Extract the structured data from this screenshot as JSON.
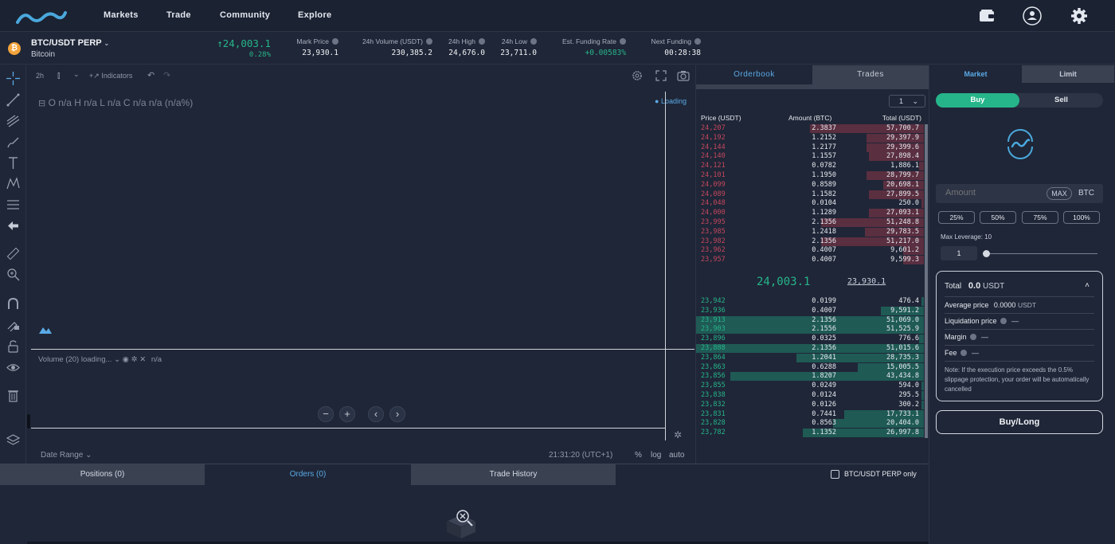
{
  "nav": {
    "links": [
      "Markets",
      "Trade",
      "Community",
      "Explore"
    ]
  },
  "ticker": {
    "pair": "BTC/USDT PERP",
    "name": "Bitcoin",
    "coin_symbol": "₿",
    "last_price": "24,003.1",
    "change": "0.28%",
    "stats": [
      {
        "label": "Mark Price",
        "value": "23,930.1"
      },
      {
        "label": "24h Volume (USDT)",
        "value": "230,385.2"
      },
      {
        "label": "24h High",
        "value": "24,676.0"
      },
      {
        "label": "24h Low",
        "value": "23,711.0"
      },
      {
        "label": "Est. Funding Rate",
        "value": "+0.00583%"
      },
      {
        "label": "Next Funding",
        "value": "00:28:38"
      }
    ]
  },
  "chart": {
    "interval": "2h",
    "indicators_label": "Indicators",
    "ohlc": "O n/a  H n/a  L n/a  C n/a  n/a (n/a%)",
    "loading": "Loading",
    "volume_label": "Volume (20) loading...",
    "volume_value": "n/a",
    "date_range": "Date Range",
    "time": "21:31:20 (UTC+1)",
    "axis_options": [
      "%",
      "log",
      "auto"
    ]
  },
  "orderbook": {
    "tabs": [
      "Orderbook",
      "Trades"
    ],
    "grouping": "1",
    "columns": [
      "Price (USDT)",
      "Amount (BTC)",
      "Total (USDT)"
    ],
    "asks": [
      {
        "price": "24,207",
        "amount": "2.3837",
        "total": "57,700.7",
        "depth": 0.5
      },
      {
        "price": "24,192",
        "amount": "1.2152",
        "total": "29,397.9",
        "depth": 0.25
      },
      {
        "price": "24,144",
        "amount": "1.2177",
        "total": "29,399.6",
        "depth": 0.25
      },
      {
        "price": "24,140",
        "amount": "1.1557",
        "total": "27,898.4",
        "depth": 0.24
      },
      {
        "price": "24,121",
        "amount": "0.0782",
        "total": "1,886.1",
        "depth": 0.02
      },
      {
        "price": "24,101",
        "amount": "1.1950",
        "total": "28,799.7",
        "depth": 0.25
      },
      {
        "price": "24,099",
        "amount": "0.8589",
        "total": "20,698.1",
        "depth": 0.18
      },
      {
        "price": "24,089",
        "amount": "1.1582",
        "total": "27,899.5",
        "depth": 0.24
      },
      {
        "price": "24,048",
        "amount": "0.0104",
        "total": "250.0",
        "depth": 0.01
      },
      {
        "price": "24,000",
        "amount": "1.1289",
        "total": "27,093.1",
        "depth": 0.24
      },
      {
        "price": "23,995",
        "amount": "2.1356",
        "total": "51,248.8",
        "depth": 0.45
      },
      {
        "price": "23,985",
        "amount": "1.2418",
        "total": "29,783.5",
        "depth": 0.26
      },
      {
        "price": "23,982",
        "amount": "2.1356",
        "total": "51,217.0",
        "depth": 0.45
      },
      {
        "price": "23,962",
        "amount": "0.4007",
        "total": "9,601.2",
        "depth": 0.09
      },
      {
        "price": "23,957",
        "amount": "0.4007",
        "total": "9,599.3",
        "depth": 0.09
      }
    ],
    "mid_price": "24,003.1",
    "mark_price": "23,930.1",
    "bids": [
      {
        "price": "23,942",
        "amount": "0.0199",
        "total": "476.4",
        "depth": 0.01
      },
      {
        "price": "23,936",
        "amount": "0.4007",
        "total": "9,591.2",
        "depth": 0.19
      },
      {
        "price": "23,913",
        "amount": "2.1356",
        "total": "51,069.0",
        "depth": 1.0
      },
      {
        "price": "23,903",
        "amount": "2.1556",
        "total": "51,525.9",
        "depth": 1.0
      },
      {
        "price": "23,896",
        "amount": "0.0325",
        "total": "776.6",
        "depth": 0.02
      },
      {
        "price": "23,888",
        "amount": "2.1356",
        "total": "51,015.6",
        "depth": 1.0
      },
      {
        "price": "23,864",
        "amount": "1.2041",
        "total": "28,735.3",
        "depth": 0.56
      },
      {
        "price": "23,863",
        "amount": "0.6288",
        "total": "15,005.5",
        "depth": 0.29
      },
      {
        "price": "23,856",
        "amount": "1.8207",
        "total": "43,434.8",
        "depth": 0.85
      },
      {
        "price": "23,855",
        "amount": "0.0249",
        "total": "594.0",
        "depth": 0.01
      },
      {
        "price": "23,838",
        "amount": "0.0124",
        "total": "295.5",
        "depth": 0.01
      },
      {
        "price": "23,832",
        "amount": "0.0126",
        "total": "300.2",
        "depth": 0.01
      },
      {
        "price": "23,831",
        "amount": "0.7441",
        "total": "17,733.1",
        "depth": 0.35
      },
      {
        "price": "23,828",
        "amount": "0.8563",
        "total": "20,404.0",
        "depth": 0.4
      },
      {
        "price": "23,782",
        "amount": "1.1352",
        "total": "26,997.8",
        "depth": 0.53
      }
    ]
  },
  "order": {
    "tabs": [
      "Market",
      "Limit"
    ],
    "buy_label": "Buy",
    "sell_label": "Sell",
    "amount_placeholder": "Amount",
    "max_label": "MAX",
    "unit": "BTC",
    "percents": [
      "25%",
      "50%",
      "75%",
      "100%"
    ],
    "max_leverage": "Max Leverage: 10",
    "leverage_value": "1",
    "total_label": "Total",
    "total_value": "0.0",
    "total_unit": "USDT",
    "rows": [
      {
        "label": "Average price",
        "value": "0.0000",
        "unit": "USDT"
      },
      {
        "label": "Liquidation price",
        "value": "—"
      },
      {
        "label": "Margin",
        "value": "—"
      },
      {
        "label": "Fee",
        "value": "—"
      }
    ],
    "note": "Note: If the execution price exceeds the 0.5% slippage protection, your order will be automatically cancelled",
    "submit": "Buy/Long"
  },
  "bottom": {
    "tabs": [
      "Positions (0)",
      "Orders (0)",
      "Trade History"
    ],
    "filter_label": "BTC/USDT PERP only"
  },
  "colors": {
    "accent": "#5aa9e6",
    "buy": "#26b58a",
    "sell": "#c4475d"
  }
}
